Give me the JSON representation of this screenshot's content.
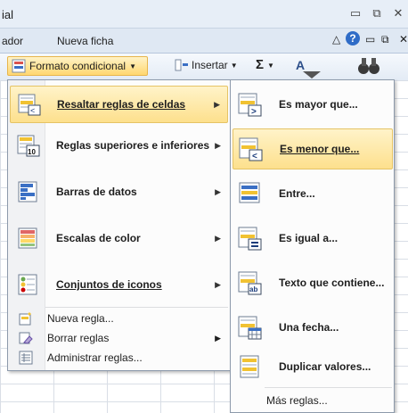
{
  "window": {
    "title_fragment": "ial"
  },
  "ribbon_tabs": {
    "left_fragment": "ador",
    "nueva_ficha": "Nueva ficha"
  },
  "ribbon": {
    "cf_button": "Formato condicional",
    "insert_button": "Insertar",
    "sigma": "Σ"
  },
  "menu1": {
    "items": [
      {
        "label": "Resaltar reglas de celdas"
      },
      {
        "label": "Reglas superiores e inferiores"
      },
      {
        "label": "Barras de datos"
      },
      {
        "label": "Escalas de color"
      },
      {
        "label": "Conjuntos de iconos"
      }
    ],
    "small_items": [
      {
        "label": "Nueva regla..."
      },
      {
        "label": "Borrar reglas"
      },
      {
        "label": "Administrar reglas..."
      }
    ]
  },
  "menu2": {
    "items": [
      {
        "label": "Es mayor que..."
      },
      {
        "label": "Es menor que..."
      },
      {
        "label": "Entre..."
      },
      {
        "label": "Es igual a..."
      },
      {
        "label": "Texto que contiene..."
      },
      {
        "label": "Una fecha..."
      },
      {
        "label": "Duplicar valores..."
      }
    ],
    "more": "Más reglas..."
  },
  "colors": {
    "highlight": "#fde08d",
    "accent_blue": "#3a6fc4"
  }
}
